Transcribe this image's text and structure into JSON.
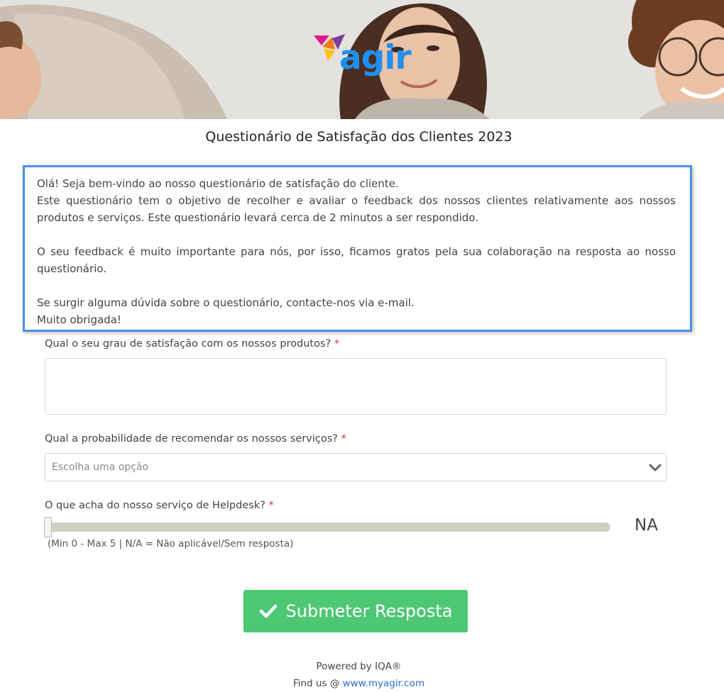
{
  "header": {
    "logo_text": "agir"
  },
  "page_title": "Questionário de Satisfação dos Clientes 2023",
  "intro": {
    "line1": "Olá! Seja bem-vindo ao nosso questionário de satisfação do cliente.",
    "line2": "Este questionário tem o objetivo de recolher e avaliar o feedback dos nossos clientes relativamente aos nossos produtos e serviços. Este questionário levará cerca de 2 minutos a ser respondido.",
    "line3": "O seu feedback é muito importante para nós, por isso, ficamos gratos pela sua colaboração na resposta ao nosso questionário.",
    "line4": "Se surgir alguma dúvida sobre o questionário, contacte-nos via e-mail.",
    "line5": "Muito obrigada!"
  },
  "questions": {
    "q1": {
      "label": "Qual o seu grau de satisfação com os nossos produtos?",
      "required_mark": "*",
      "value": ""
    },
    "q2": {
      "label": "Qual a probabilidade de recomendar os nossos serviços?",
      "required_mark": "*",
      "placeholder": "Escolha uma opção",
      "chevron_icon": "chevron-down-icon"
    },
    "q3": {
      "label": "O que acha do nosso serviço de Helpdesk?",
      "required_mark": "*",
      "slider_value": "NA",
      "slider_position": 0,
      "hint": "(Min 0 - Max 5 | N/A = Não aplicável/Sem resposta)"
    }
  },
  "submit": {
    "label": "Submeter Resposta",
    "icon": "checkmark-icon",
    "color": "#4ec774"
  },
  "footer": {
    "powered_by": "Powered by IQA®",
    "find_us_prefix": "Find us @",
    "link_text": "www.myagir.com"
  },
  "colors": {
    "accent_border": "#4a90e2",
    "logo_blue": "#1f8ff0",
    "required": "#e03030",
    "link": "#2b6fd6"
  }
}
